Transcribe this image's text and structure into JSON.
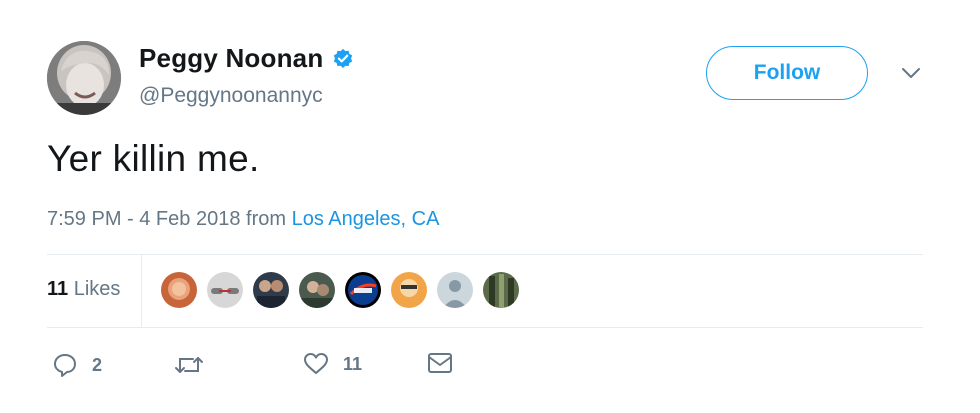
{
  "user": {
    "display_name": "Peggy Noonan",
    "handle": "@Peggynoonannyc",
    "verified": true
  },
  "follow_label": "Follow",
  "tweet": {
    "text": "Yer killin me.",
    "time": "7:59 PM - 4 Feb 2018",
    "from_label": "from",
    "location": "Los Angeles, CA"
  },
  "stats": {
    "likes_count": "11",
    "likes_label": "Likes"
  },
  "likers_count": 8,
  "actions": {
    "reply_count": "2",
    "retweet_count": "",
    "like_count": "11"
  },
  "colors": {
    "accent": "#1da1f2",
    "link": "#1b95e0",
    "muted": "#657786"
  }
}
